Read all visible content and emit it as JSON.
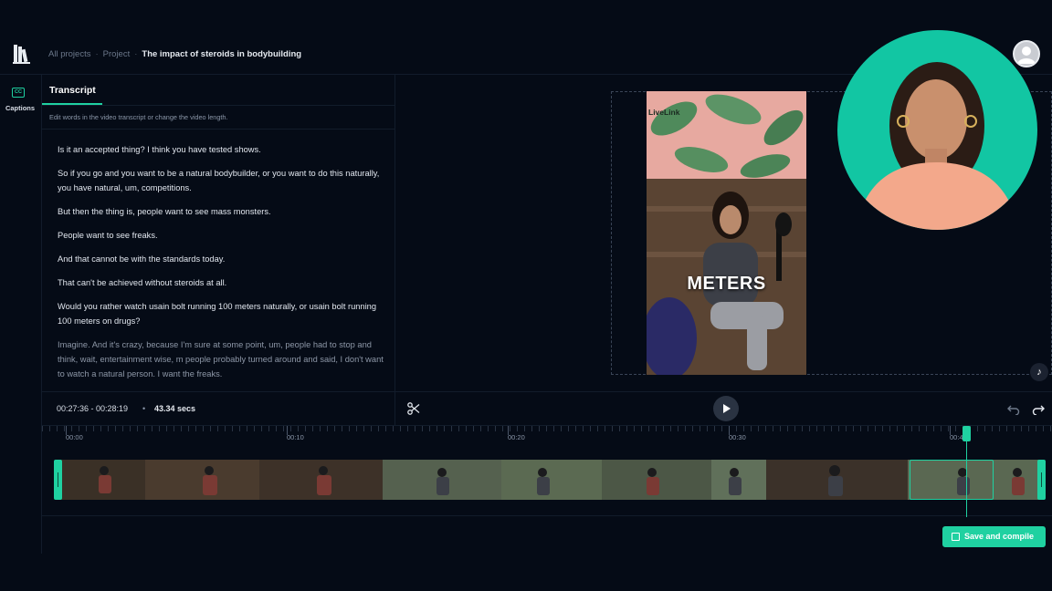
{
  "breadcrumb": {
    "all_projects": "All projects",
    "project": "Project",
    "current": "The impact of steroids in bodybuilding",
    "separator": "·"
  },
  "rail": {
    "captions_icon": "CC",
    "captions_label": "Captions"
  },
  "transcript": {
    "tab_label": "Transcript",
    "hint": "Edit words in the video transcript or change the video length.",
    "paragraphs": [
      "Is it an accepted thing? I think you have tested shows.",
      "So if you go and you want to be a natural bodybuilder, or you want to do this naturally, you have natural, um, competitions.",
      "But then the thing is, people want to see mass monsters.",
      "People want to see freaks.",
      "And that cannot be with the standards today.",
      "That can't be achieved without steroids at all.",
      "Would you rather watch usain bolt running 100 meters  naturally, or usain bolt running 100 meters on drugs?",
      "Imagine. And it's crazy, because I'm sure at some point, um, people had to stop and think, wait, entertainment wise, m people probably turned around and said, I don't want to watch a natural person. I want the freaks."
    ]
  },
  "timebar": {
    "range": "00:27:36 - 00:28:19",
    "dot": "•",
    "duration": "43.34 secs"
  },
  "preview": {
    "watermark": "LiveLink",
    "caption": "METERS",
    "tiktok_glyph": "♪"
  },
  "timeline": {
    "ticks": [
      "00:00",
      "00:10",
      "00:20",
      "00:30",
      "00:40"
    ]
  },
  "actions": {
    "save_compile": "Save and compile"
  },
  "colors": {
    "accent": "#1fd1a1",
    "background": "#050b16"
  },
  "icons": {
    "logo": "stacked-books-logo",
    "captions": "cc-icon",
    "scissors": "scissors-icon",
    "play": "play-icon",
    "undo": "undo-icon",
    "redo": "redo-icon",
    "tiktok": "tiktok-icon",
    "external": "external-link-icon",
    "avatar": "user-avatar"
  }
}
